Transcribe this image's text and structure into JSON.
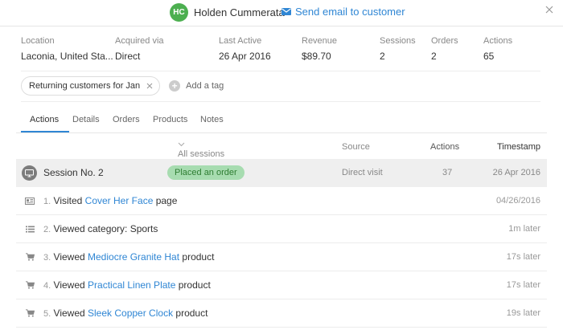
{
  "header": {
    "avatar_initials": "HC",
    "customer_name": "Holden Cummerata",
    "email_link": "Send email to customer",
    "close_icon": "close-icon"
  },
  "stats": [
    {
      "label": "Location",
      "value": "Laconia, United Sta..."
    },
    {
      "label": "Acquired via",
      "value": "Direct"
    },
    {
      "label": "Last Active",
      "value": "26 Apr 2016"
    },
    {
      "label": "Revenue",
      "value": "$89.70"
    },
    {
      "label": "Sessions",
      "value": "2"
    },
    {
      "label": "Orders",
      "value": "2"
    },
    {
      "label": "Actions",
      "value": "65"
    }
  ],
  "tags": {
    "items": [
      {
        "label": "Returning customers for Jan"
      }
    ],
    "add_label": "Add a tag"
  },
  "tabs": [
    {
      "label": "Actions",
      "active": true
    },
    {
      "label": "Details",
      "active": false
    },
    {
      "label": "Orders",
      "active": false
    },
    {
      "label": "Products",
      "active": false
    },
    {
      "label": "Notes",
      "active": false
    }
  ],
  "columns": {
    "sessions_filter": "All sessions",
    "source": "Source",
    "actions": "Actions",
    "timestamp": "Timestamp"
  },
  "session": {
    "title": "Session No. 2",
    "badge": "Placed an order",
    "source": "Direct visit",
    "actions": "37",
    "timestamp": "26 Apr 2016",
    "badge_color": "#a7dcb0"
  },
  "actions": [
    {
      "num": "1.",
      "prefix": "Visited ",
      "link": "Cover Her Face",
      "suffix": " page",
      "timestamp": "04/26/2016",
      "icon": "page-icon"
    },
    {
      "num": "2.",
      "prefix": "Viewed category: Sports",
      "link": "",
      "suffix": "",
      "timestamp": "1m later",
      "icon": "list-icon"
    },
    {
      "num": "3.",
      "prefix": "Viewed ",
      "link": "Mediocre Granite Hat",
      "suffix": " product",
      "timestamp": "17s later",
      "icon": "cart-icon"
    },
    {
      "num": "4.",
      "prefix": "Viewed ",
      "link": "Practical Linen Plate",
      "suffix": " product",
      "timestamp": "17s later",
      "icon": "cart-icon"
    },
    {
      "num": "5.",
      "prefix": "Viewed ",
      "link": "Sleek Copper Clock",
      "suffix": " product",
      "timestamp": "19s later",
      "icon": "cart-icon"
    }
  ],
  "colors": {
    "accent": "#2f86d4",
    "avatar": "#4caf50"
  }
}
